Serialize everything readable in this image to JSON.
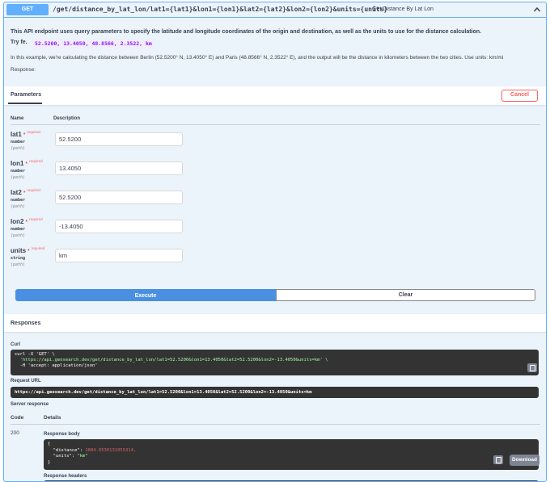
{
  "operation": {
    "method": "GET",
    "path": "/get/distance_by_lat_lon/lat1={lat1}&lon1={lon1}&lat2={lat2}&lon2={lon2}&units={units}",
    "summary": "Get Distance By Lat Lon"
  },
  "description": {
    "intro": "This API endpoint uses query parameters to specify the latitude and longitude coordinates of the origin and destination, as well as the units to use for the distance calculation.",
    "try_label": "Try fe.",
    "try_code": "52.5200, 13.4050, 48.8566, 2.3522, km",
    "example": "In this example, we're calculating the distance between Berlin (52.5200° N, 13.4050° E) and Paris (48.8566° N, 2.3522° E), and the output will be the distance in kilometers between the two cities. Use units: km/mi",
    "response_label": "Response:"
  },
  "parameters": {
    "tab_label": "Parameters",
    "cancel_label": "Cancel",
    "col_name": "Name",
    "col_description": "Description",
    "required_label": "required",
    "items": [
      {
        "name": "lat1",
        "type": "number",
        "in": "(path)",
        "value": "52.5200"
      },
      {
        "name": "lon1",
        "type": "number",
        "in": "(path)",
        "value": "13.4050"
      },
      {
        "name": "lat2",
        "type": "number",
        "in": "(path)",
        "value": "52.5200"
      },
      {
        "name": "lon2",
        "type": "number",
        "in": "(path)",
        "value": "-13.4050"
      },
      {
        "name": "units",
        "type": "string",
        "in": "(path)",
        "value": "km"
      }
    ]
  },
  "actions": {
    "execute_label": "Execute",
    "clear_label": "Clear"
  },
  "responses": {
    "title": "Responses",
    "curl_label": "Curl",
    "curl_line1": "curl -X 'GET' \\",
    "curl_line2": "  'https://api.geosearch.dev/get/distance_by_lat_lon/lat1=52.5200&lon1=13.4050&lat2=52.5200&lon2=-13.4050&units=km' \\",
    "curl_line3": "  -H 'accept: application/json'",
    "request_url_label": "Request URL",
    "request_url": "https://api.geosearch.dev/get/distance_by_lat_lon/lat1=52.5200&lon1=13.4050&lat2=52.5200&lon2=-13.4050&units=km",
    "server_response_label": "Server response",
    "col_code": "Code",
    "col_details": "Details",
    "code": "200",
    "body_label": "Response body",
    "body_open": "{",
    "body_distance_key": "  \"distance\": ",
    "body_distance_value": "1804.0530131055314,",
    "body_units_key": "  \"units\": ",
    "body_units_value": "\"km\"",
    "body_close": "}",
    "download_label": "Download",
    "headers_label": "Response headers"
  },
  "colors": {
    "get_blue": "#61affe",
    "execute_blue": "#4990e2",
    "cancel_red": "#ff6060",
    "code_bg": "#333333"
  },
  "icons": {
    "chevron": "chevron-up-icon",
    "copy": "copy-icon"
  }
}
